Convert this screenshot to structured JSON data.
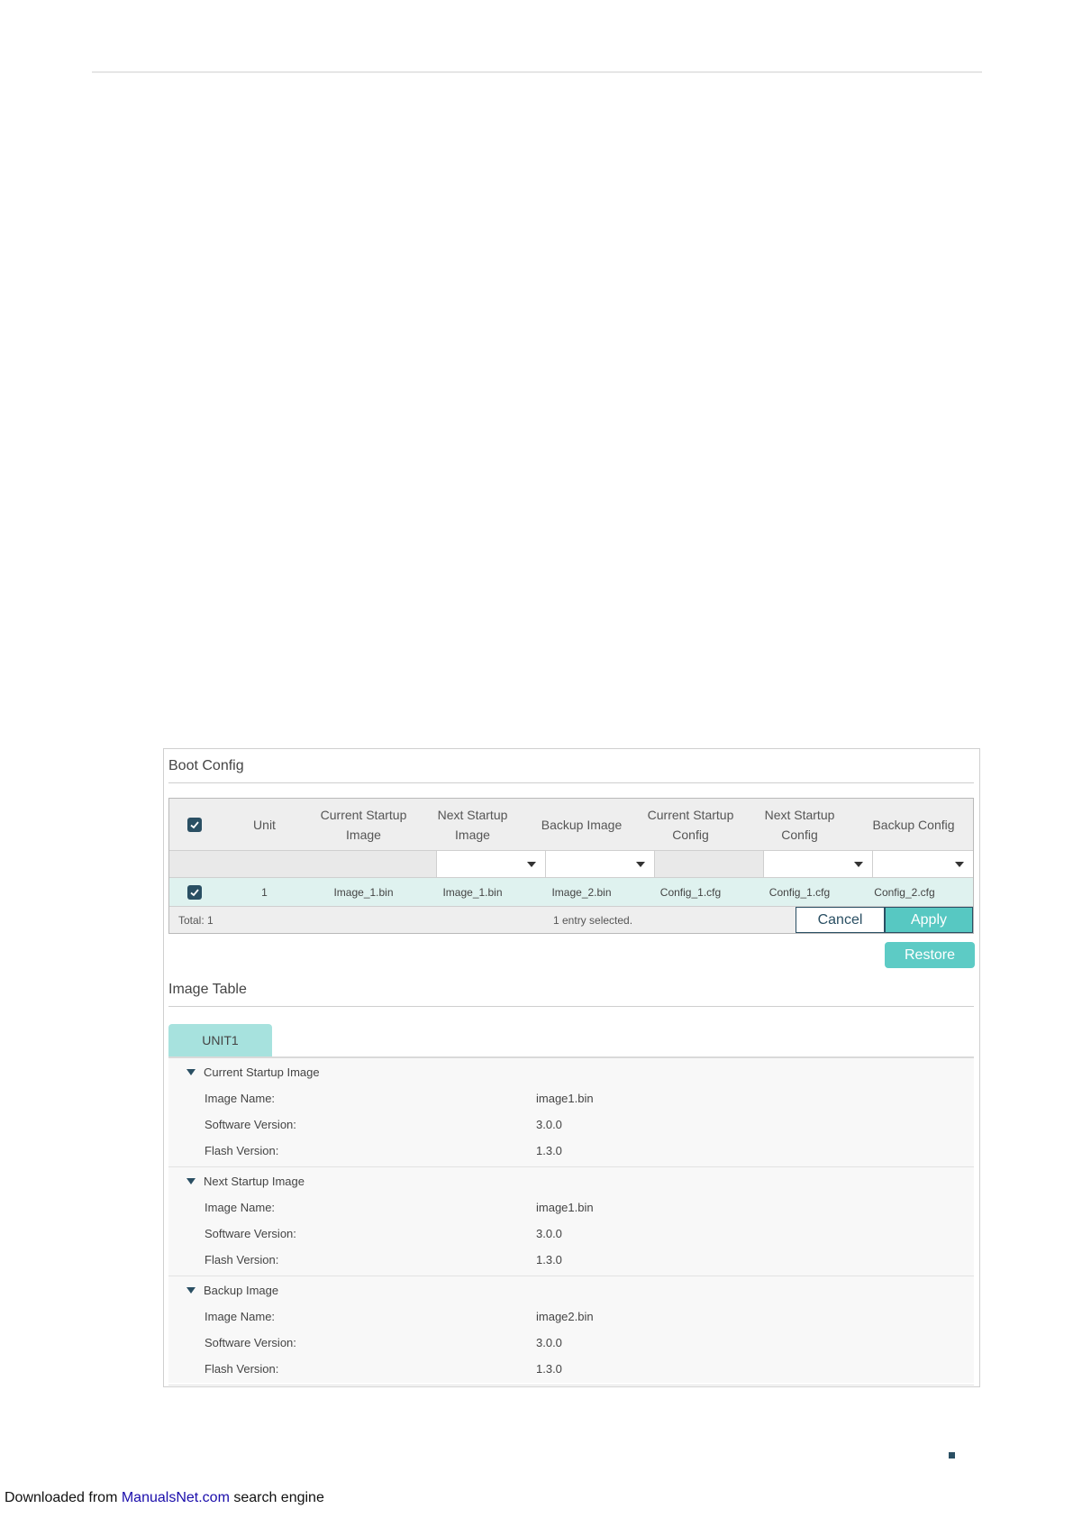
{
  "boot_config": {
    "title": "Boot Config",
    "columns": [
      "Unit",
      "Current Startup Image",
      "Next Startup Image",
      "Backup Image",
      "Current Startup Config",
      "Next Startup Config",
      "Backup Config"
    ],
    "rows": [
      {
        "unit": "1",
        "current_startup_image": "Image_1.bin",
        "next_startup_image": "Image_1.bin",
        "backup_image": "Image_2.bin",
        "current_startup_config": "Config_1.cfg",
        "next_startup_config": "Config_1.cfg",
        "backup_config": "Config_2.cfg"
      }
    ],
    "total_label": "Total: 1",
    "selected_label": "1 entry selected.",
    "cancel_label": "Cancel",
    "apply_label": "Apply",
    "restore_label": "Restore"
  },
  "image_table": {
    "title": "Image Table",
    "tab_label": "UNIT1",
    "groups": [
      {
        "title": "Current Startup Image",
        "fields": [
          {
            "label": "Image Name:",
            "value": "image1.bin"
          },
          {
            "label": "Software Version:",
            "value": "3.0.0"
          },
          {
            "label": "Flash Version:",
            "value": "1.3.0"
          }
        ]
      },
      {
        "title": "Next Startup Image",
        "fields": [
          {
            "label": "Image Name:",
            "value": "image1.bin"
          },
          {
            "label": "Software Version:",
            "value": "3.0.0"
          },
          {
            "label": "Flash Version:",
            "value": "1.3.0"
          }
        ]
      },
      {
        "title": "Backup Image",
        "fields": [
          {
            "label": "Image Name:",
            "value": "image2.bin"
          },
          {
            "label": "Software Version:",
            "value": "3.0.0"
          },
          {
            "label": "Flash Version:",
            "value": "1.3.0"
          }
        ]
      }
    ]
  },
  "footer": {
    "prefix": "Downloaded from ",
    "link_text": "ManualsNet.com",
    "suffix": " search engine"
  },
  "colors": {
    "accent": "#57c8c2",
    "selected_row": "#dff2ef",
    "checkbox": "#2a4f63"
  }
}
